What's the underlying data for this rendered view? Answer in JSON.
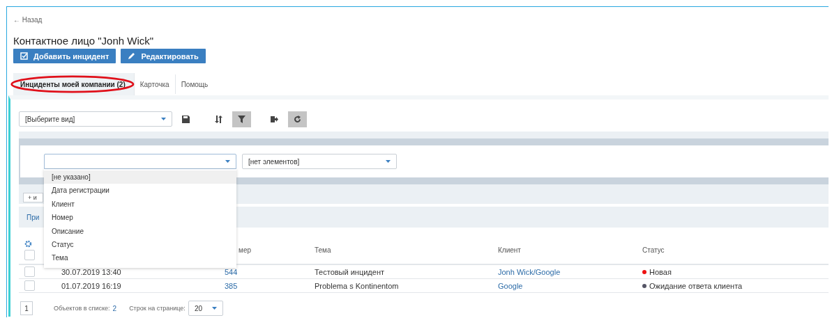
{
  "back_link": "← Назад",
  "title": "Контактное лицо \"Jonh Wick\"",
  "actions": [
    {
      "kind": "add",
      "label": "Добавить инцидент"
    },
    {
      "kind": "edit",
      "label": "Редактировать"
    }
  ],
  "tabs": [
    {
      "label": "Инциденты моей компании (2)",
      "selected": true,
      "circled": true
    },
    {
      "label": "Карточка",
      "selected": false,
      "circled": false
    },
    {
      "label": "Помощь",
      "selected": false,
      "circled": false
    }
  ],
  "view_select": {
    "value": "[Выберите вид]"
  },
  "toolbar": [
    {
      "kind": "save",
      "active": false
    },
    {
      "kind": "sort",
      "active": false
    },
    {
      "kind": "filter",
      "active": true
    },
    {
      "kind": "export",
      "active": false
    },
    {
      "kind": "refresh",
      "active": true
    }
  ],
  "filter": {
    "field_select": {
      "expanded": true,
      "options": [
        {
          "label": "[не указано]",
          "selected": true
        },
        {
          "label": "Дата регистрации",
          "selected": false
        },
        {
          "label": "Клиент",
          "selected": false
        },
        {
          "label": "Номер",
          "selected": false
        },
        {
          "label": "Описание",
          "selected": false
        },
        {
          "label": "Статус",
          "selected": false
        },
        {
          "label": "Тема",
          "selected": false
        }
      ]
    },
    "value_select": {
      "value": "[нет элементов]"
    }
  },
  "add_condition": "+ и",
  "apply_link": "При",
  "table": {
    "all_checked": false,
    "columns": [
      "мер",
      "Тема",
      "Клиент",
      "Статус"
    ],
    "rows": [
      {
        "checked": false,
        "date": "30.07.2019 13:40",
        "number": "544",
        "subject": "Тестовый инцидент",
        "client": "Jonh Wick/Google",
        "status": "Новая",
        "color": "#ee1111"
      },
      {
        "checked": false,
        "date": "01.07.2019 16:19",
        "number": "385",
        "subject": "Problema s Kontinentom",
        "client": "Google",
        "status": "Ожидание ответа клиента",
        "color": "#555566"
      }
    ]
  },
  "footer": {
    "page": "1",
    "count_label": "Объектов в списке:",
    "count": "2",
    "rows_label": "Строк на странице:",
    "rows_per_page": "20"
  }
}
